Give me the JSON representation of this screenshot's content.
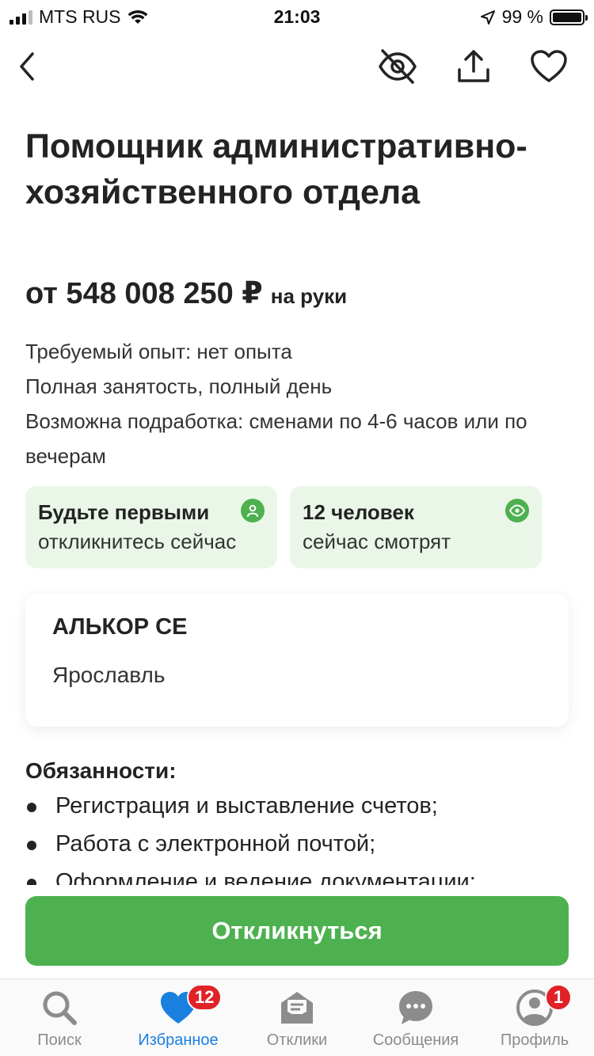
{
  "status_bar": {
    "carrier": "MTS RUS",
    "time": "21:03",
    "battery": "99 %"
  },
  "nav": {
    "back_icon": "chevron-left-icon",
    "hide_icon": "eye-off-icon",
    "share_icon": "share-icon",
    "favorite_icon": "heart-icon"
  },
  "vacancy": {
    "title": "Помощник административно-хозяйственного отдела",
    "salary_amount": "от 548 008 250 ₽",
    "salary_suffix": "на руки",
    "conditions": [
      "Требуемый опыт: нет опыта",
      "Полная занятость, полный день",
      "Возможна подработка: сменами по 4-6 часов или по вечерам"
    ]
  },
  "info_cards": [
    {
      "line1": "Будьте первыми",
      "line2": "откликнитесь сейчас",
      "icon": "person-icon"
    },
    {
      "line1": "12 человек",
      "line2": "сейчас смотрят",
      "icon": "eye-icon"
    }
  ],
  "company": {
    "name": "АЛЬКОР СЕ",
    "city": "Ярославль"
  },
  "duties": {
    "title": "Обязанности:",
    "items": [
      "Регистрация и выставление счетов;",
      "Работа с электронной почтой;",
      "Оформление и ведение документации;"
    ]
  },
  "respond_button": "Откликнуться",
  "tabbar": {
    "tabs": [
      {
        "label": "Поиск",
        "icon": "search-icon",
        "badge": ""
      },
      {
        "label": "Избранное",
        "icon": "heart-icon",
        "badge": "12"
      },
      {
        "label": "Отклики",
        "icon": "mail-icon",
        "badge": ""
      },
      {
        "label": "Сообщения",
        "icon": "chat-icon",
        "badge": ""
      },
      {
        "label": "Профиль",
        "icon": "profile-icon",
        "badge": "1"
      }
    ],
    "active_index": 1
  },
  "colors": {
    "accent_green": "#4db14f",
    "card_green": "#eaf7e8",
    "active_blue": "#1a80e0",
    "badge_red": "#e02228"
  }
}
